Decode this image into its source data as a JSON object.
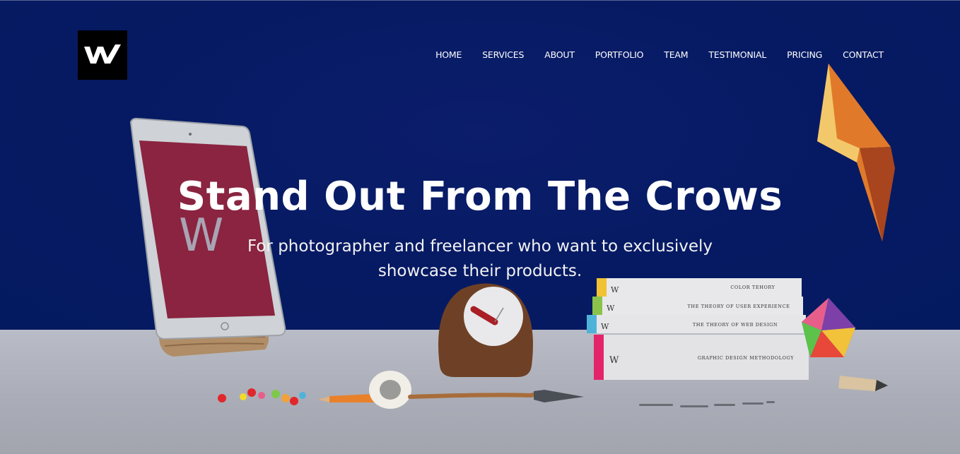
{
  "brand": {
    "logo_letter": "W"
  },
  "nav": {
    "items": [
      {
        "label": "HOME"
      },
      {
        "label": "SERVICES"
      },
      {
        "label": "ABOUT"
      },
      {
        "label": "PORTFOLIO"
      },
      {
        "label": "TEAM"
      },
      {
        "label": "TESTIMONIAL"
      },
      {
        "label": "PRICING"
      },
      {
        "label": "CONTACT"
      }
    ]
  },
  "hero": {
    "title": "Stand Out From The Crows",
    "subtitle_line1": "For photographer and freelancer who want to exclusively",
    "subtitle_line2": "showcase their products."
  },
  "books": {
    "titles": [
      "COLOR TEHORY",
      "THE THEORY OF USER EXPERIENCE",
      "THE THEORY OF WEB DESIGN",
      "GRAPHIC DESIGN METHODOLOGY"
    ]
  },
  "colors": {
    "wall": "#061a63",
    "floor": "#aeb1bb",
    "tablet_screen": "#8a2440",
    "text": "#ffffff"
  }
}
